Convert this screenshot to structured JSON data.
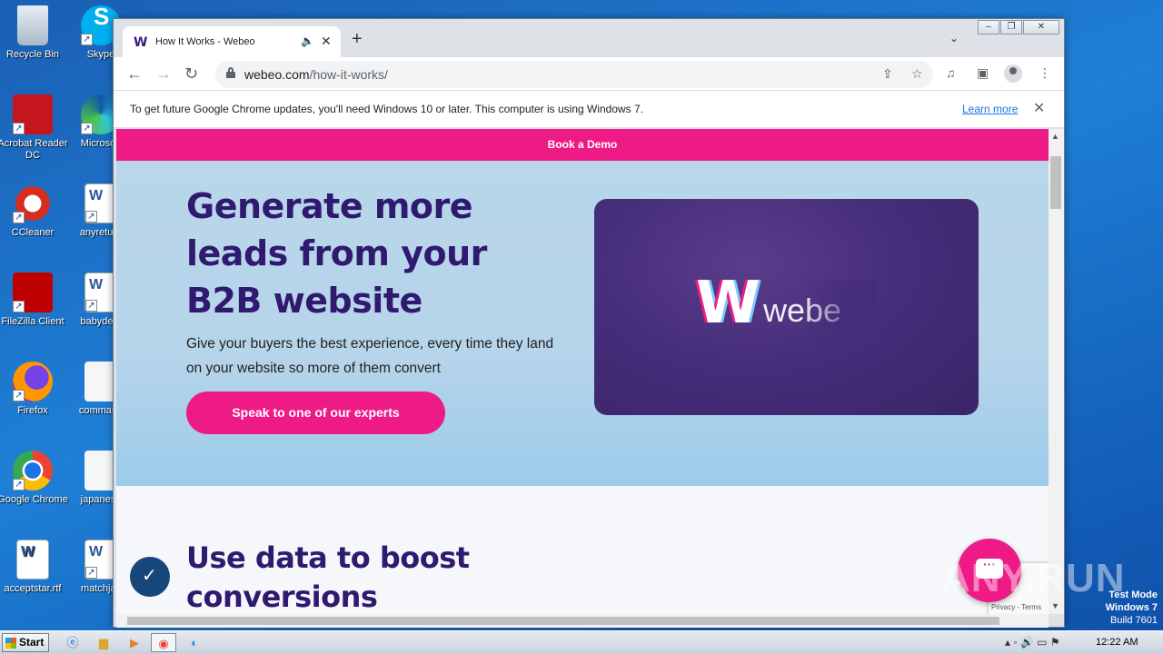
{
  "desktop": {
    "icons_col1": [
      "Recycle Bin",
      "Acrobat Reader DC",
      "CCleaner",
      "FileZilla Client",
      "Firefox",
      "Google Chrome",
      "acceptstar.rtf"
    ],
    "icons_col2": [
      "Skype",
      "Microsoft",
      "anyreturn",
      "babydeat",
      "command",
      "japanese",
      "matchjac"
    ]
  },
  "browser": {
    "tab_title": "How It Works - Webeo",
    "tab_favicon": "W",
    "url_host": "webeo.com",
    "url_path": "/how-it-works/",
    "infobar_message": "To get future Google Chrome updates, you'll need Windows 10 or later. This computer is using Windows 7.",
    "infobar_link": "Learn more"
  },
  "page": {
    "demo_bar": "Book a Demo",
    "hero_title": "Generate more leads from your B2B website",
    "hero_sub": "Give your buyers the best experience, every time they land on your website so more of them convert",
    "cta": "Speak to one of our experts",
    "video_logo": "W",
    "video_text": "webe",
    "section2_title": "Use data to boost conversions",
    "chat_glyph": "···",
    "recaptcha_text": "Privacy - Terms"
  },
  "overlay": {
    "watermark": "ANY.RUN",
    "test_mode": [
      "Test Mode",
      "Windows 7",
      "Build 7601"
    ]
  },
  "taskbar": {
    "start": "Start",
    "clock": "12:22 AM"
  },
  "colors": {
    "brand_pink": "#ee1b86",
    "brand_purple": "#2f1a6f",
    "hero_blue": "#b9d6ea"
  }
}
